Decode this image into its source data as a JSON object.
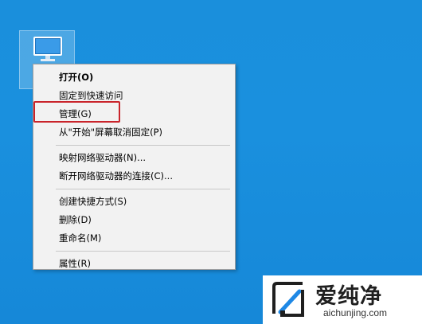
{
  "menu": {
    "items": [
      {
        "label": "打开(O)",
        "bold": true
      },
      {
        "label": "固定到快速访问"
      },
      {
        "label": "管理(G)"
      },
      {
        "label": "从\"开始\"屏幕取消固定(P)"
      },
      {
        "label": "映射网络驱动器(N)..."
      },
      {
        "label": "断开网络驱动器的连接(C)..."
      },
      {
        "label": "创建快捷方式(S)"
      },
      {
        "label": "删除(D)"
      },
      {
        "label": "重命名(M)"
      },
      {
        "label": "属性(R)"
      }
    ]
  },
  "watermark": {
    "title": "爱纯净",
    "url": "aichunjing.com"
  },
  "colors": {
    "desktop": "#1a8fdc",
    "highlight": "#c9242b",
    "menu_bg": "#f2f2f2"
  },
  "icons": {
    "desktop_icon": "this-pc-monitor-icon",
    "watermark_logo": "aichunjing-logo-icon"
  }
}
